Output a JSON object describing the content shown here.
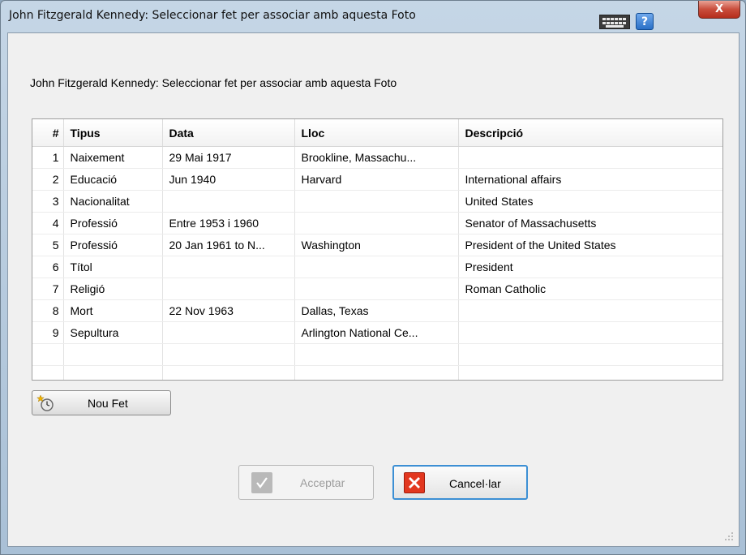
{
  "window": {
    "title": "John Fitzgerald Kennedy: Seleccionar fet per associar amb aquesta Foto",
    "help_label": "?",
    "close_label": "X"
  },
  "heading": "John Fitzgerald Kennedy: Seleccionar fet per associar amb aquesta Foto",
  "table": {
    "columns": [
      "#",
      "Tipus",
      "Data",
      "Lloc",
      "Descripció"
    ],
    "rows": [
      [
        "1",
        "Naixement",
        "29 Mai 1917",
        "Brookline, Massachu...",
        ""
      ],
      [
        "2",
        "Educació",
        "Jun 1940",
        "Harvard",
        "International affairs"
      ],
      [
        "3",
        "Nacionalitat",
        "",
        "",
        "United States"
      ],
      [
        "4",
        "Professió",
        "Entre 1953 i 1960",
        "",
        "Senator of Massachusetts"
      ],
      [
        "5",
        "Professió",
        "20 Jan 1961 to N...",
        "Washington",
        "President of the United States"
      ],
      [
        "6",
        "Títol",
        "",
        "",
        "President"
      ],
      [
        "7",
        "Religió",
        "",
        "",
        "Roman Catholic"
      ],
      [
        "8",
        "Mort",
        "22 Nov 1963",
        "Dallas, Texas",
        ""
      ],
      [
        "9",
        "Sepultura",
        "",
        "Arlington National Ce...",
        ""
      ]
    ]
  },
  "buttons": {
    "new_event": "Nou Fet",
    "accept": "Acceptar",
    "cancel": "Cancel·lar"
  },
  "icons": {
    "keyboard": "keyboard-icon",
    "help": "help-icon",
    "close": "close-icon",
    "new_event": "new-event-icon",
    "accept": "checkmark-icon",
    "cancel": "x-icon"
  },
  "colors": {
    "accent": "#3c8fd4",
    "cancel_icon": "#e2371f",
    "close_button": "#c94d3c"
  }
}
